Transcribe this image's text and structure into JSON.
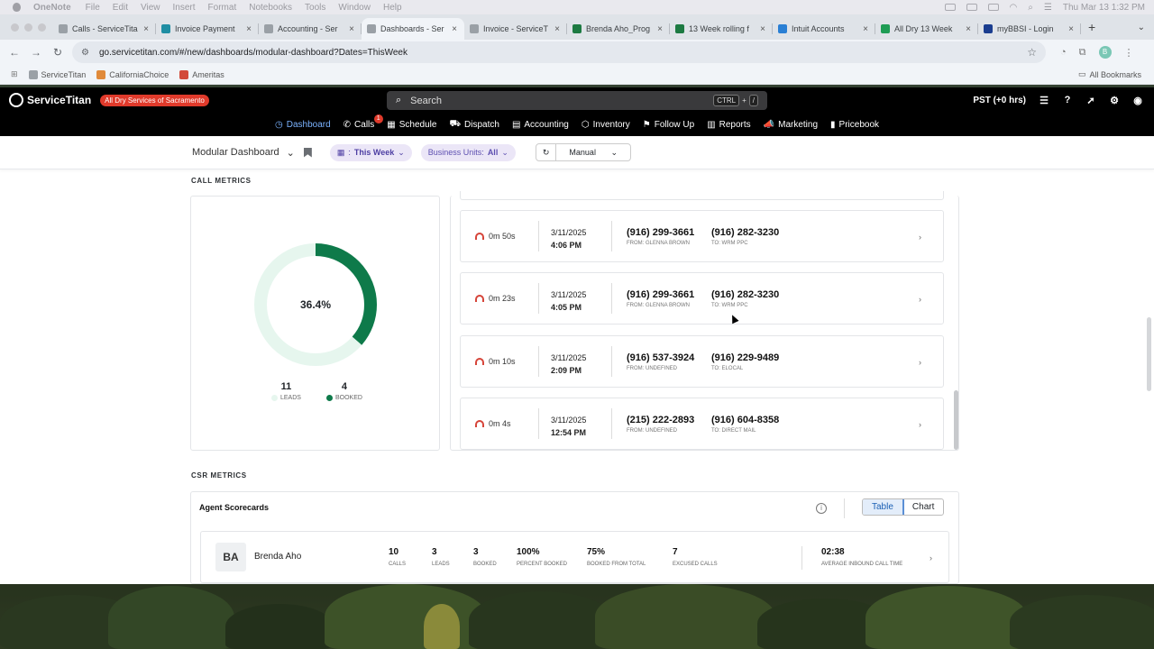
{
  "macbar": {
    "app": "OneNote",
    "menus": [
      "File",
      "Edit",
      "View",
      "Insert",
      "Format",
      "Notebooks",
      "Tools",
      "Window",
      "Help"
    ],
    "clock": "Thu Mar 13  1:32 PM"
  },
  "tabs": [
    {
      "label": "Calls - ServiceTita",
      "color": "#9aa0a6"
    },
    {
      "label": "Invoice Payment",
      "color": "#1f8ea3"
    },
    {
      "label": "Accounting - Ser",
      "color": "#9aa0a6"
    },
    {
      "label": "Dashboards - Ser",
      "color": "#9aa0a6",
      "active": true
    },
    {
      "label": "Invoice - ServiceT",
      "color": "#9aa0a6"
    },
    {
      "label": "Brenda Aho_Prog",
      "color": "#1d7a42"
    },
    {
      "label": "13 Week rolling f",
      "color": "#1d7a42"
    },
    {
      "label": "Intuit Accounts",
      "color": "#2a7fd4"
    },
    {
      "label": "All Dry 13 Week",
      "color": "#1f9d55"
    },
    {
      "label": "myBBSI - Login",
      "color": "#1a3d8f"
    }
  ],
  "url": "go.servicetitan.com/#/new/dashboards/modular-dashboard?Dates=ThisWeek",
  "bookmarks": [
    {
      "label": "ServiceTitan",
      "color": "#9aa0a6"
    },
    {
      "label": "CaliforniaChoice",
      "color": "#e08a3a"
    },
    {
      "label": "Ameritas",
      "color": "#d24a3a"
    }
  ],
  "bookmarks_all": "All Bookmarks",
  "header": {
    "brand": "ServiceTitan",
    "tenant": "All Dry Services of Sacramento",
    "search_placeholder": "Search",
    "kbd1": "CTRL",
    "kbd_plus": "+",
    "kbd2": "/",
    "timezone": "PST (+0 hrs)"
  },
  "nav": [
    {
      "label": "Dashboard",
      "icon": "◷",
      "active": true
    },
    {
      "label": "Calls",
      "icon": "✆",
      "badge": "1"
    },
    {
      "label": "Schedule",
      "icon": "▦"
    },
    {
      "label": "Dispatch",
      "icon": "⛟"
    },
    {
      "label": "Accounting",
      "icon": "▤"
    },
    {
      "label": "Inventory",
      "icon": "⬡"
    },
    {
      "label": "Follow Up",
      "icon": "⚑"
    },
    {
      "label": "Reports",
      "icon": "▥"
    },
    {
      "label": "Marketing",
      "icon": "📣"
    },
    {
      "label": "Pricebook",
      "icon": "▮"
    }
  ],
  "filters": {
    "dashboard": "Modular Dashboard",
    "date_prefix": ":",
    "date_value": "This Week",
    "bu_label": "Business Units:",
    "bu_value": "All",
    "refresh_mode": "Manual"
  },
  "call_metrics": {
    "title": "CALL METRICS",
    "percent": "36.4%",
    "percent_value": 0.364,
    "leads": "11",
    "leads_label": "LEADS",
    "booked": "4",
    "booked_label": "BOOKED",
    "colors": {
      "booked": "#0e7a4a",
      "leads": "#e6f6ee"
    },
    "calls": [
      {
        "duration": "0m 50s",
        "date": "3/11/2025",
        "time": "4:06 PM",
        "from": "(916) 299-3661",
        "from_label": "FROM: GLENNA BROWN",
        "to": "(916) 282-3230",
        "to_label": "TO: WRM PPC"
      },
      {
        "duration": "0m 23s",
        "date": "3/11/2025",
        "time": "4:05 PM",
        "from": "(916) 299-3661",
        "from_label": "FROM: GLENNA BROWN",
        "to": "(916) 282-3230",
        "to_label": "TO: WRM PPC"
      },
      {
        "duration": "0m 10s",
        "date": "3/11/2025",
        "time": "2:09 PM",
        "from": "(916) 537-3924",
        "from_label": "FROM: UNDEFINED",
        "to": "(916) 229-9489",
        "to_label": "TO: ELOCAL"
      },
      {
        "duration": "0m 4s",
        "date": "3/11/2025",
        "time": "12:54 PM",
        "from": "(215) 222-2893",
        "from_label": "FROM: UNDEFINED",
        "to": "(916) 604-8358",
        "to_label": "TO: DIRECT MAIL"
      }
    ]
  },
  "csr_metrics": {
    "title": "CSR METRICS",
    "card_title": "Agent Scorecards",
    "toggle_table": "Table",
    "toggle_chart": "Chart",
    "agent": {
      "initials": "BA",
      "name": "Brenda Aho",
      "stats": [
        {
          "value": "10",
          "label": "CALLS"
        },
        {
          "value": "3",
          "label": "LEADS"
        },
        {
          "value": "3",
          "label": "BOOKED"
        },
        {
          "value": "100%",
          "label": "PERCENT BOOKED"
        },
        {
          "value": "75%",
          "label": "BOOKED FROM TOTAL"
        },
        {
          "value": "7",
          "label": "EXCUSED CALLS"
        }
      ],
      "avg_time": "02:38",
      "avg_time_label": "AVERAGE INBOUND CALL TIME"
    }
  }
}
